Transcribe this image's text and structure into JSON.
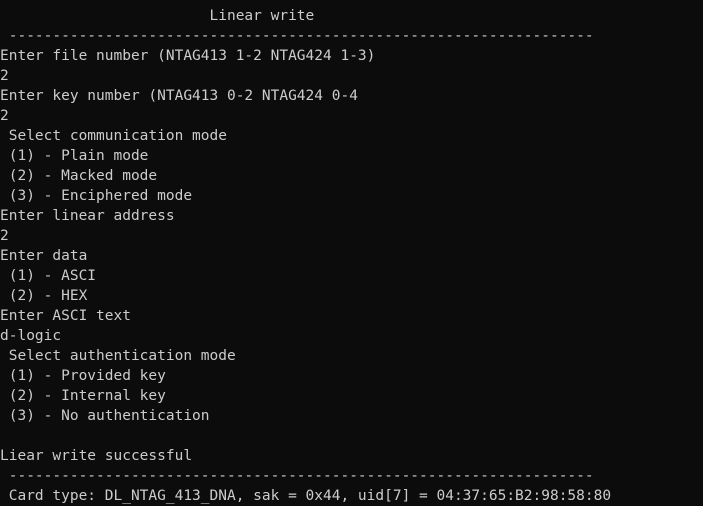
{
  "console": {
    "lines": [
      "                        Linear write",
      " -------------------------------------------------------------------",
      "Enter file number (NTAG413 1-2 NTAG424 1-3)",
      "2",
      "Enter key number (NTAG413 0-2 NTAG424 0-4",
      "2",
      " Select communication mode",
      " (1) - Plain mode",
      " (2) - Macked mode",
      " (3) - Enciphered mode",
      "Enter linear address",
      "2",
      "Enter data",
      " (1) - ASCI",
      " (2) - HEX",
      "Enter ASCI text",
      "d-logic",
      " Select authentication mode",
      " (1) - Provided key",
      " (2) - Internal key",
      " (3) - No authentication",
      "",
      "Liear write successful",
      " -------------------------------------------------------------------",
      " Card type: DL_NTAG_413_DNA, sak = 0x44, uid[7] = 04:37:65:B2:98:58:80"
    ]
  }
}
